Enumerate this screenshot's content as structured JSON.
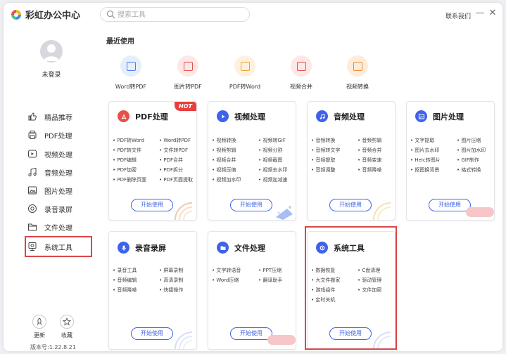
{
  "app": {
    "title": "彩虹办公中心",
    "contact": "联系我们",
    "minimize": "—",
    "close": "✕"
  },
  "search": {
    "placeholder": "搜索工具"
  },
  "user": {
    "login": "未登录"
  },
  "sidebar": {
    "items": [
      {
        "label": "精品推荐",
        "icon": "thumbs-up-icon"
      },
      {
        "label": "PDF处理",
        "icon": "pdf-icon"
      },
      {
        "label": "视频处理",
        "icon": "video-icon"
      },
      {
        "label": "音频处理",
        "icon": "music-icon"
      },
      {
        "label": "图片处理",
        "icon": "image-icon"
      },
      {
        "label": "录音录屏",
        "icon": "record-icon"
      },
      {
        "label": "文件处理",
        "icon": "folder-icon"
      },
      {
        "label": "系统工具",
        "icon": "system-icon"
      }
    ],
    "active": "系统工具",
    "bottom": {
      "update": "更新",
      "favorite": "收藏"
    },
    "version": "版本号:1.22.8.21"
  },
  "recent": {
    "title": "最近使用",
    "items": [
      {
        "label": "Word转PDF",
        "color": "#4a7de8",
        "bg": "#e6eefc"
      },
      {
        "label": "图片转PDF",
        "color": "#e8504a",
        "bg": "#fde8e7"
      },
      {
        "label": "PDF转Word",
        "color": "#f0a030",
        "bg": "#fdf1de"
      },
      {
        "label": "视频合并",
        "color": "#e8504a",
        "bg": "#fde8e7"
      },
      {
        "label": "视频转换",
        "color": "#f08a30",
        "bg": "#fdecd9"
      }
    ]
  },
  "cards": [
    {
      "title": "PDF处理",
      "color": "#e8504a",
      "hot": "HOT",
      "items": [
        "PDF转Word",
        "Word转PDF",
        "PDF转文件",
        "文件转PDF",
        "PDF编辑",
        "PDF合并",
        "PDF加密",
        "PDF拆分",
        "PDF删除页面",
        "PDF页面提取"
      ],
      "button": "开始使用"
    },
    {
      "title": "视频处理",
      "color": "#3f63e8",
      "items": [
        "视频转换",
        "视频转GIF",
        "视频剪辑",
        "视频分割",
        "视频合并",
        "视频截图",
        "视频压缩",
        "视频去水印",
        "视频加水印",
        "视频加减速"
      ],
      "button": "开始使用"
    },
    {
      "title": "音频处理",
      "color": "#3f63e8",
      "items": [
        "音频转换",
        "音频剪辑",
        "音频转文字",
        "音频合并",
        "音频提取",
        "音频变速",
        "音频调整",
        "音频降噪"
      ],
      "button": "开始使用"
    },
    {
      "title": "图片处理",
      "color": "#3f63e8",
      "items": [
        "文字提取",
        "图片压缩",
        "图片去水印",
        "图片加水印",
        "Heic转图片",
        "GIF制作",
        "抠图换背景",
        "格式转换"
      ],
      "button": "开始使用"
    },
    {
      "title": "录音录屏",
      "color": "#3f63e8",
      "items": [
        "录音工具",
        "屏幕录制",
        "音频编辑",
        "高清录制",
        "音频降噪",
        "快捷操作"
      ],
      "button": "开始使用"
    },
    {
      "title": "文件处理",
      "color": "#3f63e8",
      "items": [
        "文字转语音",
        "PPT压缩",
        "Word压缩",
        "翻译助手"
      ],
      "button": "开始使用"
    },
    {
      "title": "系统工具",
      "color": "#3f63e8",
      "items": [
        "数据恢复",
        "C盘清理",
        "大文件搬家",
        "驱动管理",
        "游戏组件",
        "文件加密",
        "定时关机"
      ],
      "button": "开始使用"
    }
  ]
}
